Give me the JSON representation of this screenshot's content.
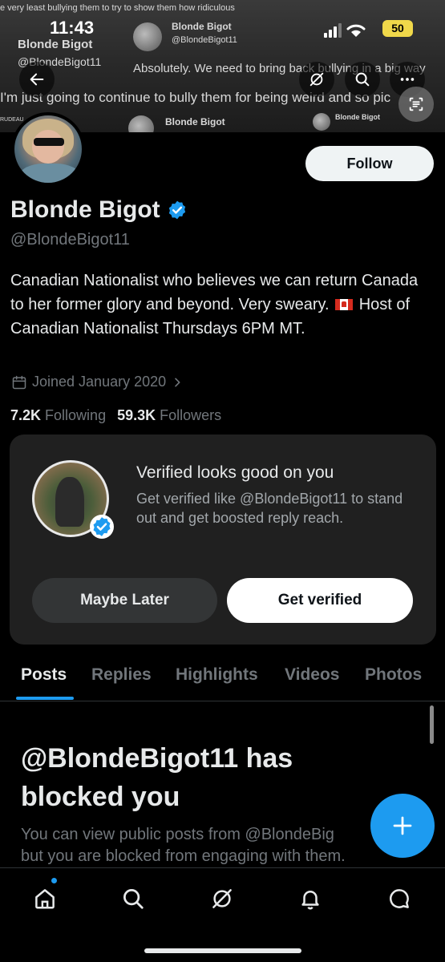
{
  "status_bar": {
    "time": "11:43",
    "battery": "50"
  },
  "banner": {
    "top_text": "e very least bullying them to try to show them how ridiculous",
    "name1": "Blonde Bigot",
    "handle1": "@BlondeBigot11",
    "name2": "Blonde Bigot",
    "handle2": "@BlondeBigot11",
    "line1": "Absolutely. We need to bring back bullying in a big way",
    "line2": "I'm just going to continue to bully them for being weird and so pic",
    "name3": "Blonde Bigot",
    "name4": "Blonde Bigot",
    "trudeau": "RUDEAU"
  },
  "profile": {
    "name": "Blonde Bigot",
    "handle": "@BlondeBigot11",
    "follow_label": "Follow",
    "bio_part1": "Canadian Nationalist who believes we can return Canada to her former glory and beyond. Very sweary.",
    "bio_part2": "Host of Canadian Nationalist Thursdays 6PM MT.",
    "joined": "Joined January 2020",
    "following_count": "7.2K",
    "following_label": "Following",
    "followers_count": "59.3K",
    "followers_label": "Followers"
  },
  "verified_card": {
    "title": "Verified looks good on you",
    "subtitle": "Get verified like @BlondeBigot11 to stand out and get boosted reply reach.",
    "later_label": "Maybe Later",
    "verify_label": "Get verified"
  },
  "tabs": [
    "Posts",
    "Replies",
    "Highlights",
    "Videos",
    "Photos"
  ],
  "blocked": {
    "title": "@BlondeBigot11 has blocked you",
    "line1": "You can view public posts from @BlondeBig",
    "line2": "but you are blocked from engaging with them."
  },
  "colors": {
    "accent": "#1d9bf0",
    "background": "#000000",
    "card": "#202020"
  }
}
